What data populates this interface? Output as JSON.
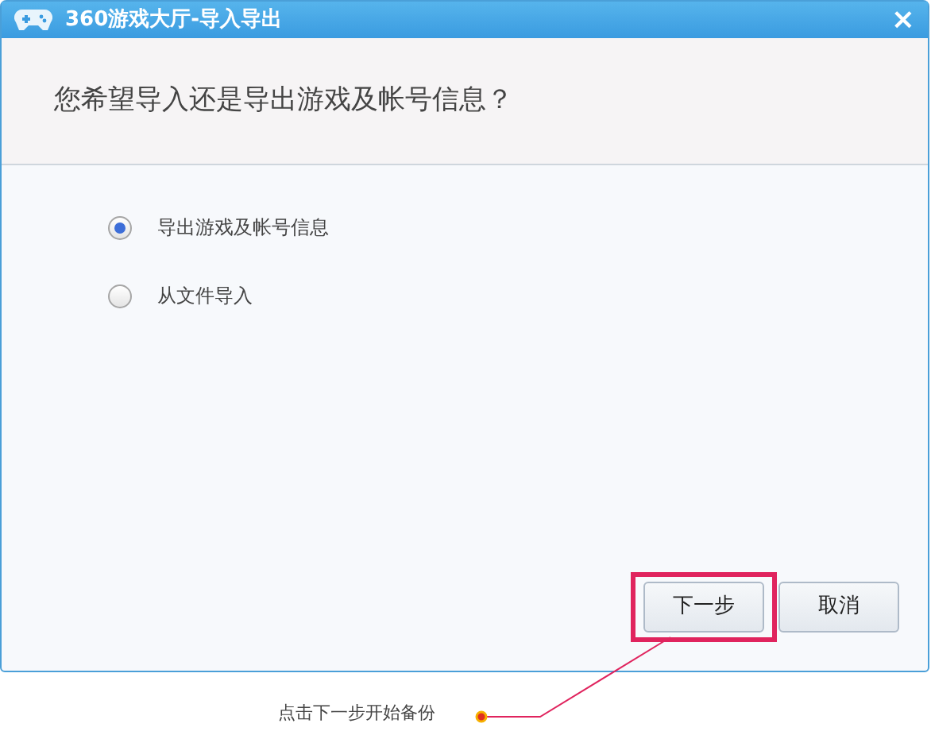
{
  "window": {
    "title": "360游戏大厅-导入导出",
    "close": "×"
  },
  "question": "您希望导入还是导出游戏及帐号信息？",
  "options": [
    {
      "label": "导出游戏及帐号信息",
      "selected": true
    },
    {
      "label": "从文件导入",
      "selected": false
    }
  ],
  "buttons": [
    {
      "label": "下一步",
      "highlighted": true
    },
    {
      "label": "取消",
      "highlighted": false
    }
  ],
  "annotation": {
    "text": "点击下一步开始备份"
  }
}
